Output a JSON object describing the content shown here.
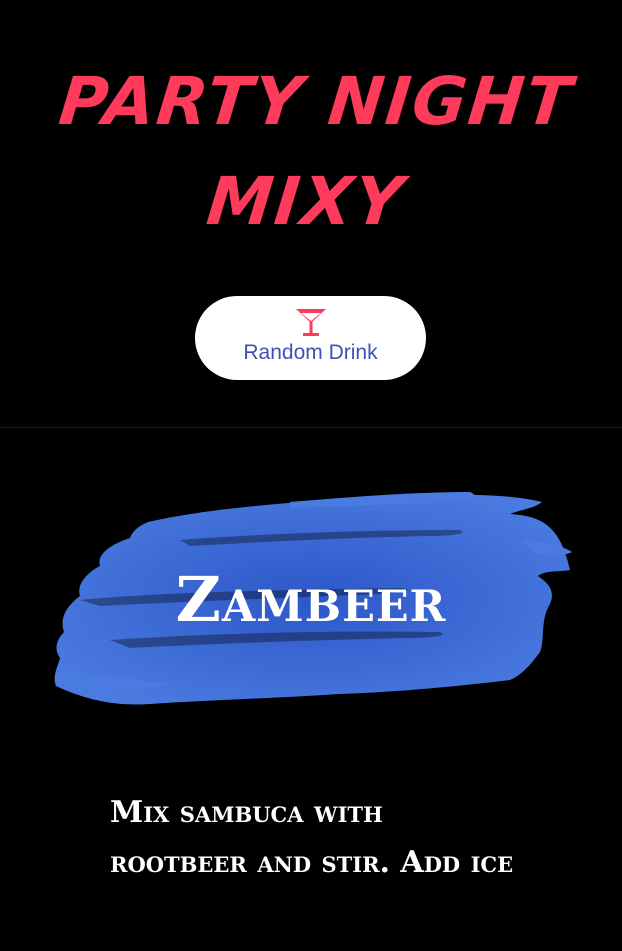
{
  "header": {
    "title_line1": "PARTY NIGHT",
    "title_line2": "MIXY"
  },
  "random_button": {
    "icon": "cocktail-icon",
    "label": "Random Drink"
  },
  "drink": {
    "name": "Zambeer",
    "instructions": "Mix sambuca with rootbeer and stir. Add ice"
  },
  "colors": {
    "background": "#000000",
    "title": "#ff3b5c",
    "button_bg": "#ffffff",
    "button_text": "#3f51b5",
    "icon": "#ff3b5c",
    "brush": "#3d6fd6",
    "text": "#ffffff"
  }
}
